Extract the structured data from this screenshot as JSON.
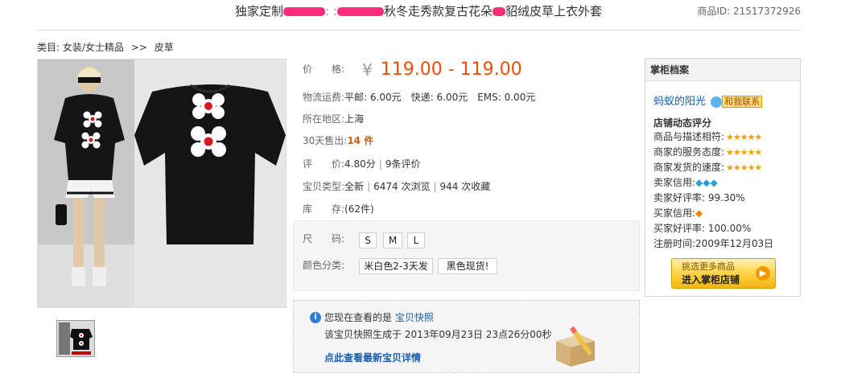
{
  "header": {
    "title_left": "独家定制",
    "title_right": "秋冬走秀款复古花朵",
    "title_end": "貂绒皮草上衣外套",
    "item_id": "商品ID: 21517372926"
  },
  "breadcrumb": {
    "prefix": "类目:",
    "category": "女装/女士精品",
    "separator": ">>",
    "subcategory": "皮草"
  },
  "details": {
    "price_label": "价　　格:",
    "price_symbol": "¥",
    "price_value": "119.00 - 119.00",
    "shipping_label": "物流运费:",
    "shipping_value": "平邮: 6.00元　快递: 6.00元　EMS: 0.00元",
    "region_label": "所在地区:",
    "region_value": "上海",
    "sold_label": "30天售出:",
    "sold_value": "14 件",
    "rating_label": "评　　价:",
    "rating_score": "4.80分",
    "rating_count": "9条评价",
    "type_label": "宝贝类型:",
    "type_condition": "全新",
    "type_views": "6474 次浏览",
    "type_favorites": "944 次收藏",
    "stock_label": "库　　存:",
    "stock_value": "(62件)"
  },
  "sku": {
    "size_label": "尺　　码:",
    "sizes": [
      "S",
      "M",
      "L"
    ],
    "color_label": "颜色分类:",
    "colors": [
      "米白色2-3天发",
      "黑色现货!"
    ]
  },
  "snapshot": {
    "notice": "您现在查看的是",
    "notice_link": "宝贝快照",
    "generated": "该宝贝快照生成于 2013年09月23日 23点26分00秒",
    "latest_link": "点此查看最新宝贝详情"
  },
  "seller": {
    "heading": "掌柜档案",
    "name": "蚂蚁的阳光",
    "contact": "和我联系",
    "dsr_title": "店铺动态评分",
    "dsr_desc": "商品与描述相符:",
    "dsr_service": "商家的服务态度:",
    "dsr_ship": "商家发货的速度:",
    "seller_credit": "卖家信用:",
    "seller_rate_label": "卖家好评率:",
    "seller_rate": "99.30%",
    "buyer_credit": "买家信用:",
    "buyer_rate_label": "买家好评率:",
    "buyer_rate": "100.00%",
    "reg_label": "注册时间:",
    "reg_date": "2009年12月03日",
    "btn_line1": "挑选更多商品",
    "btn_line2": "进入掌柜店铺"
  },
  "colors": {
    "price": "#f04d0a",
    "link": "#1a5ea8",
    "sold": "#c6620c"
  }
}
